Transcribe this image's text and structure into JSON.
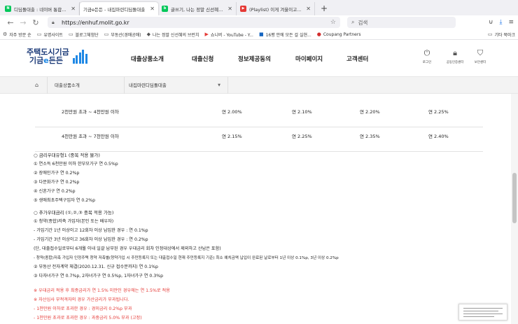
{
  "browser": {
    "tabs": [
      {
        "label": "디딤돌대출 : 네이버 통합검색",
        "favicon": "naver-icon",
        "active": false
      },
      {
        "label": "기금e든든 - 내집마련디딤돌대출",
        "favicon": "fund-icon",
        "active": true
      },
      {
        "label": "글쓰기, 나는 정말 신선혜 : 네이버 블로그",
        "favicon": "naver-blog-icon",
        "active": false
      },
      {
        "label": "(Playlist) 이게 겨울이고 렌디고 | 유",
        "favicon": "youtube-icon",
        "active": false
      }
    ],
    "new_tab": "+",
    "url": "https://enhuf.molit.go.kr",
    "search_placeholder": "검색",
    "bookmarks": [
      {
        "label": "자주 방문 순",
        "icon": "gear-icon"
      },
      {
        "label": "유명사이트",
        "icon": "folder-icon"
      },
      {
        "label": "블로그체험단",
        "icon": "folder-icon"
      },
      {
        "label": "부동산(경매공매)",
        "icon": "folder-icon"
      },
      {
        "label": "나는 정말 신선혜의 브런치",
        "icon": "brunch-icon"
      },
      {
        "label": "쇼니버 - YouTube - Y...",
        "icon": "youtube-icon"
      },
      {
        "label": "16평 안에 모든 걸 실현...",
        "icon": "blog-icon"
      },
      {
        "label": "Coupang Partners",
        "icon": "coupang-icon"
      }
    ],
    "other_bookmarks": "기타 북마크"
  },
  "site": {
    "logo_line1": "주택도시기금",
    "logo_line2_a": "기금",
    "logo_line2_e": "e",
    "logo_line2_b": "든든",
    "nav": [
      "대출상품소개",
      "대출신청",
      "정보제공동의",
      "마이페이지",
      "고객센터"
    ],
    "utils": [
      {
        "label": "로그인",
        "icon": "power-icon"
      },
      {
        "label": "공동인증센터",
        "icon": "lock-icon"
      },
      {
        "label": "보안센터",
        "icon": "shield-icon"
      }
    ],
    "breadcrumb": {
      "home_icon": "home-icon",
      "level1": "대출상품소개",
      "level2": "내집마련디딤돌대출"
    }
  },
  "rate_table": {
    "rows": [
      {
        "label": "2천만원 초과 ~ 4천만원 이하",
        "values": [
          "연 2.00%",
          "연 2.10%",
          "연 2.20%",
          "연 2.25%"
        ]
      },
      {
        "label": "4천만원 초과 ~ 7천만원 이하",
        "values": [
          "연 2.15%",
          "연 2.25%",
          "연 2.35%",
          "연 2.40%"
        ]
      }
    ]
  },
  "conditions": {
    "preferential_head": "○ 금리우대유형1 (중복 적용 불가)",
    "preferential_items": [
      "① 연소득 6천만원 이하 한부모가구 연 0.5%p",
      "② 장애인가구 연 0.2%p",
      "③ 다문화가구 연 0.2%p",
      "④ 신혼가구 연 0.2%p",
      "⑤ 생애최초주택구입자 연 0.2%p"
    ],
    "additional_head": "○ 추가우대금리 (①,②,③ 중복 적용 가능)",
    "additional_items": [
      "① 청약(종합)저축 가입자(본인 또는 배우자)",
      "- 가입기간 1년 이상이고 12회차 이상 납입한 경우 : 연 0.1%p",
      "- 가입기간 3년 이상이고 36회차 이상 납입한 경우 : 연 0.2%p",
      "(단, 대출접수일로부터 6개월 이내 일괄 납부된 경우 우대금리 회차 인정대상에서 제외하고 산납은 포함)",
      "- 청약(종합)저축 가입자 인정주택 청약 저축별(청약가입 시 주민등록지 또는 대출접수일 현재 주민등록지 기준) 최소 예치금액 납입이 완료된 날로부터 1년 이상 0.1%p, 3년 이상 0.2%p",
      "② 부동산 전자계약 체결(2020.12.31. 신규 접수분까지) 연 0.1%p",
      "③ 다자녀가구 연 0.7%p, 2자녀가구 연 0.5%p, 1자녀가구 연 0.3%p"
    ],
    "notes": [
      "※ 우대금리 적용 후 최종금리가 연 1.5% 미만인 경우에는 연 1.5%로 적용",
      "※ 자산심사 부적격자의 경우 가산금리가 부과됩니다.",
      "- 1천만원 이하로 초과한 경우 : 경미금리 0.2%p 부과",
      "- 1천만원 초과로 초과한 경우 : 과중금리 5.0% 부과 (고정)"
    ]
  },
  "colors": {
    "brand_navy": "#1b3a78",
    "brand_blue": "#1e88e5",
    "notice_red": "#e53935"
  }
}
